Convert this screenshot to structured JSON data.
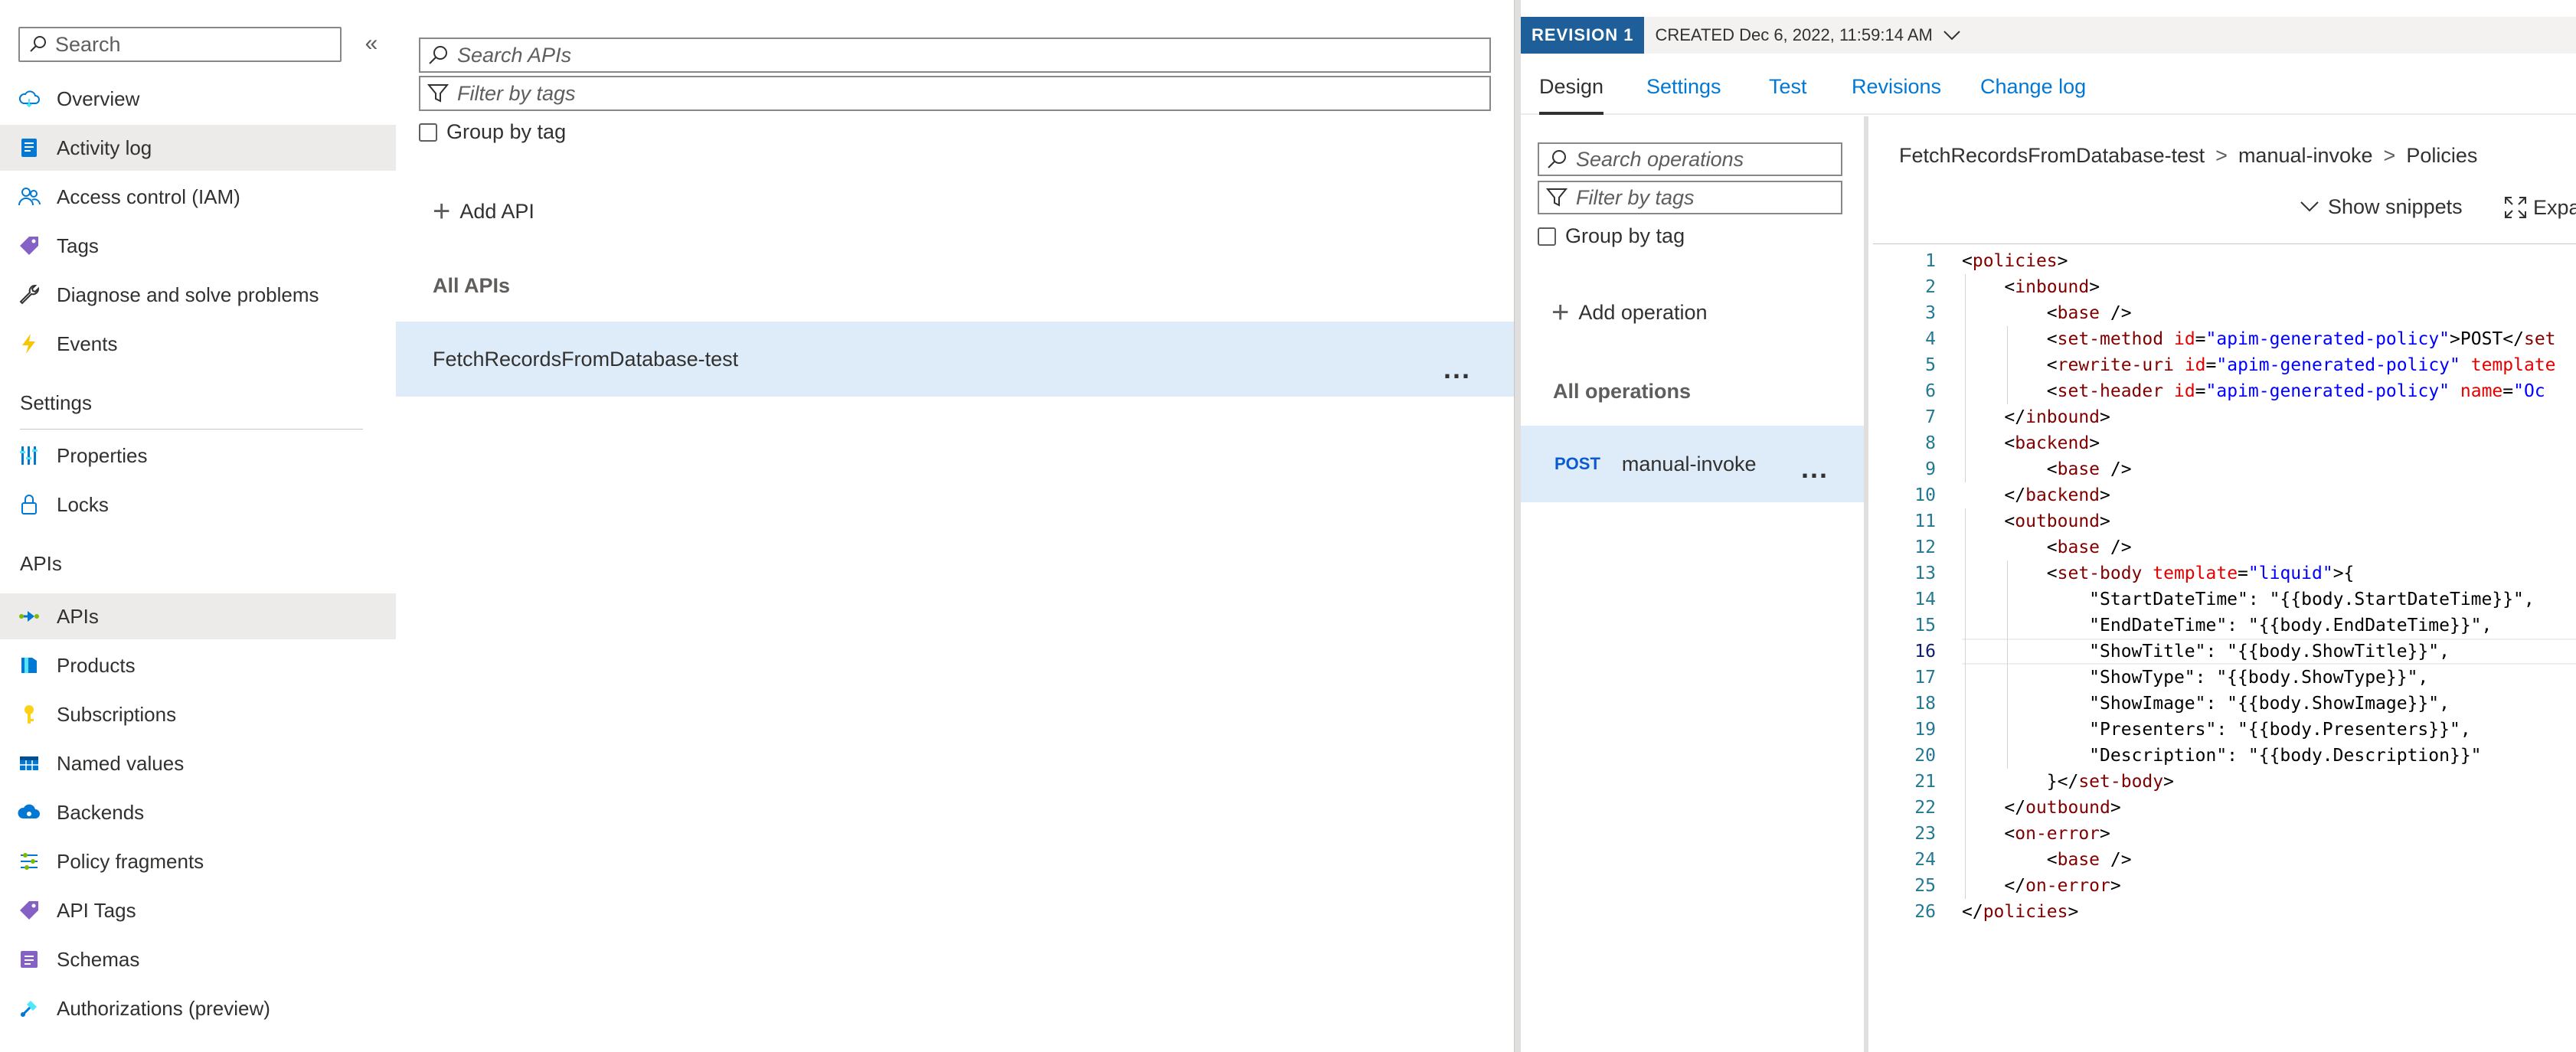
{
  "nav": {
    "search_placeholder": "Search",
    "collapse_glyph": "«",
    "items_top": [
      {
        "label": "Overview",
        "icon": "cloud-icon"
      },
      {
        "label": "Activity log",
        "icon": "activity-log-icon",
        "selected": true
      },
      {
        "label": "Access control (IAM)",
        "icon": "people-icon"
      },
      {
        "label": "Tags",
        "icon": "tag-icon"
      },
      {
        "label": "Diagnose and solve problems",
        "icon": "wrench-icon"
      },
      {
        "label": "Events",
        "icon": "lightning-icon"
      }
    ],
    "settings_header": "Settings",
    "settings_items": [
      {
        "label": "Properties",
        "icon": "properties-icon"
      },
      {
        "label": "Locks",
        "icon": "lock-icon"
      }
    ],
    "apis_header": "APIs",
    "apis_items": [
      {
        "label": "APIs",
        "icon": "api-icon",
        "selected": true
      },
      {
        "label": "Products",
        "icon": "product-icon"
      },
      {
        "label": "Subscriptions",
        "icon": "key-icon"
      },
      {
        "label": "Named values",
        "icon": "table-icon"
      },
      {
        "label": "Backends",
        "icon": "backend-cloud-icon"
      },
      {
        "label": "Policy fragments",
        "icon": "policy-fragment-icon"
      },
      {
        "label": "API Tags",
        "icon": "tag-icon"
      },
      {
        "label": "Schemas",
        "icon": "schema-icon"
      },
      {
        "label": "Authorizations (preview)",
        "icon": "authorization-icon"
      }
    ]
  },
  "api_list": {
    "search_placeholder": "Search APIs",
    "filter_placeholder": "Filter by tags",
    "group_by_tag": "Group by tag",
    "add_api": "Add API",
    "group_header": "All APIs",
    "apis": [
      {
        "name": "FetchRecordsFromDatabase-test",
        "more": "..."
      }
    ]
  },
  "revision": {
    "badge": "REVISION 1",
    "created": "CREATED Dec 6, 2022, 11:59:14 AM"
  },
  "tabs": [
    "Design",
    "Settings",
    "Test",
    "Revisions",
    "Change log"
  ],
  "operations": {
    "search_placeholder": "Search operations",
    "filter_placeholder": "Filter by tags",
    "group_by_tag": "Group by tag",
    "add_operation": "Add operation",
    "group_header": "All operations",
    "items": [
      {
        "verb": "POST",
        "name": "manual-invoke",
        "more": "..."
      }
    ]
  },
  "editor": {
    "breadcrumb": [
      "FetchRecordsFromDatabase-test",
      "manual-invoke",
      "Policies"
    ],
    "breadcrumb_sep": ">",
    "show_snippets": "Show snippets",
    "expand": "Expa",
    "current_line": 16,
    "lines": [
      "<policies>",
      "    <inbound>",
      "        <base />",
      "        <set-method id=\"apim-generated-policy\">POST</set",
      "        <rewrite-uri id=\"apim-generated-policy\" template",
      "        <set-header id=\"apim-generated-policy\" name=\"Oc",
      "    </inbound>",
      "    <backend>",
      "        <base />",
      "    </backend>",
      "    <outbound>",
      "        <base />",
      "        <set-body template=\"liquid\">{",
      "            \"StartDateTime\": \"{{body.StartDateTime}}\",",
      "            \"EndDateTime\": \"{{body.EndDateTime}}\",",
      "            \"ShowTitle\": \"{{body.ShowTitle}}\",",
      "            \"ShowType\": \"{{body.ShowType}}\",",
      "            \"ShowImage\": \"{{body.ShowImage}}\",",
      "            \"Presenters\": \"{{body.Presenters}}\",",
      "            \"Description\": \"{{body.Description}}\"",
      "        }</set-body>",
      "    </outbound>",
      "    <on-error>",
      "        <base />",
      "    </on-error>",
      "</policies>"
    ]
  },
  "colors": {
    "accent": "#0078d4",
    "selected_row": "#deecf9",
    "nav_selected": "#edebe9",
    "revision_badge": "#1f5f99",
    "xml_tag": "#800000",
    "xml_attr_name": "#e50000",
    "xml_attr_value": "#0000ff"
  }
}
